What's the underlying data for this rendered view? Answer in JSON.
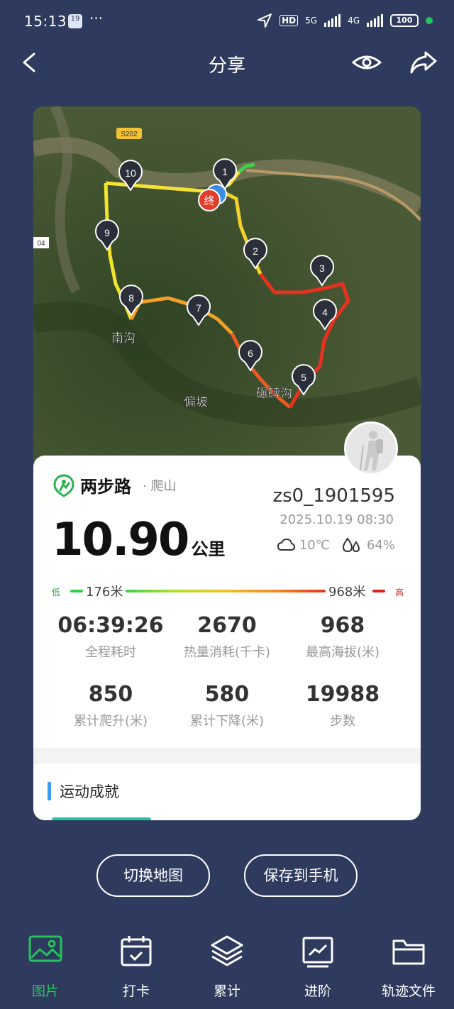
{
  "status": {
    "time": "15:13",
    "badge": "19",
    "dots": "···",
    "hd": "HD",
    "net_5g": "5G",
    "net_4g": "4G",
    "battery": "100"
  },
  "header": {
    "title": "分享"
  },
  "map": {
    "labels": {
      "road": "S202",
      "road_side": "04",
      "south_gully": "南沟",
      "pianpo": "偏坡",
      "village": "碾磚沟",
      "end": "终"
    },
    "checkpoints": [
      "1",
      "2",
      "3",
      "4",
      "5",
      "6",
      "7",
      "8",
      "9",
      "10"
    ]
  },
  "card": {
    "brand": "两步路",
    "activity": "· 爬山",
    "username": "zs0_1901595",
    "datetime": "2025.10.19 08:30",
    "distance": "10.90",
    "distance_unit": "公里",
    "temperature": "10℃",
    "humidity": "64%",
    "altitude": {
      "low_label": "低",
      "low": "176米",
      "high": "968米",
      "high_label": "高"
    },
    "stats": [
      {
        "value": "06:39:26",
        "label": "全程耗时"
      },
      {
        "value": "2670",
        "label": "热量消耗(千卡)"
      },
      {
        "value": "968",
        "label": "最高海拔(米)"
      },
      {
        "value": "850",
        "label": "累计爬升(米)"
      },
      {
        "value": "580",
        "label": "累计下降(米)"
      },
      {
        "value": "19988",
        "label": "步数"
      }
    ],
    "achievements_title": "运动成就"
  },
  "actions": {
    "switch_map": "切换地图",
    "save_phone": "保存到手机"
  },
  "tabs": [
    {
      "label": "图片",
      "active": true
    },
    {
      "label": "打卡"
    },
    {
      "label": "累计"
    },
    {
      "label": "进阶"
    },
    {
      "label": "轨迹文件"
    }
  ],
  "colors": {
    "background": "#2f3b5e",
    "active_tab": "#25c45a",
    "accent_blue": "#3a9cf0"
  }
}
